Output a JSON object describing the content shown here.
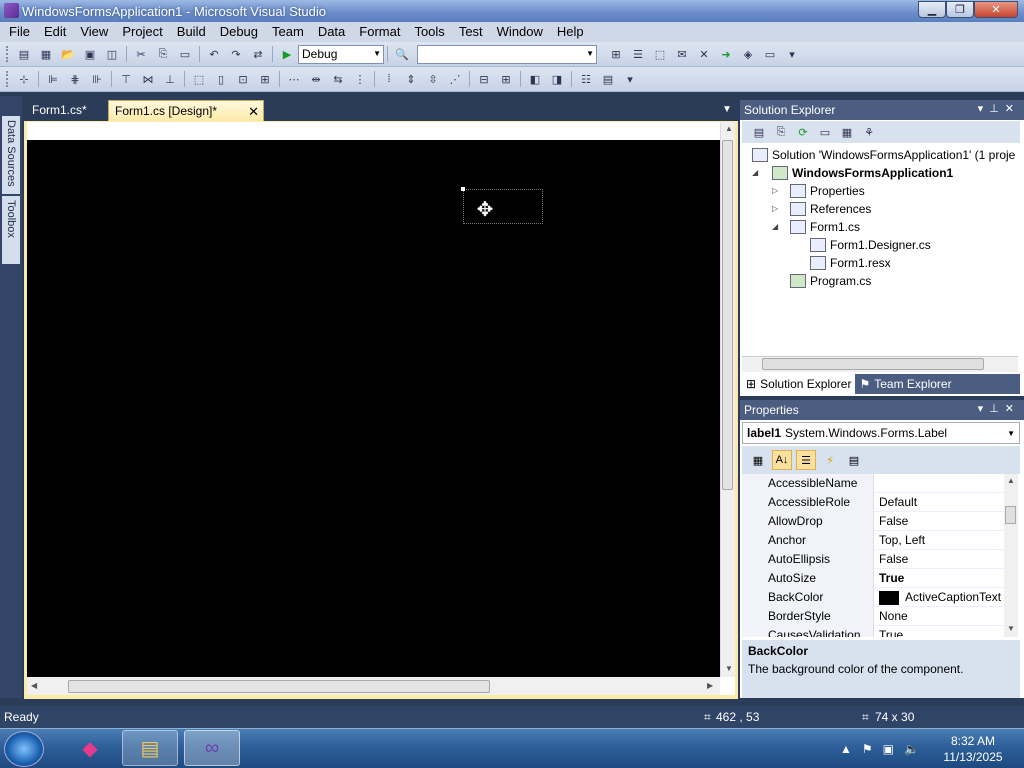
{
  "window": {
    "title": "WindowsFormsApplication1 - Microsoft Visual Studio"
  },
  "menu": [
    "File",
    "Edit",
    "View",
    "Project",
    "Build",
    "Debug",
    "Team",
    "Data",
    "Format",
    "Tools",
    "Test",
    "Window",
    "Help"
  ],
  "toolbar": {
    "configuration": "Debug",
    "platform": ""
  },
  "side_tabs": {
    "data_sources": "Data Sources",
    "toolbox": "Toolbox"
  },
  "doc_tabs": {
    "code": "Form1.cs*",
    "designer": "Form1.cs [Design]*"
  },
  "solution_explorer": {
    "title": "Solution Explorer",
    "items": [
      {
        "label": "Solution 'WindowsFormsApplication1' (1 proje"
      },
      {
        "label": "WindowsFormsApplication1"
      },
      {
        "label": "Properties"
      },
      {
        "label": "References"
      },
      {
        "label": "Form1.cs"
      },
      {
        "label": "Form1.Designer.cs"
      },
      {
        "label": "Form1.resx"
      },
      {
        "label": "Program.cs"
      }
    ],
    "tab_solution": "Solution Explorer",
    "tab_team": "Team Explorer"
  },
  "properties": {
    "title": "Properties",
    "object_name": "label1",
    "object_type": "System.Windows.Forms.Label",
    "rows": [
      {
        "name": "AccessibleName",
        "value": ""
      },
      {
        "name": "AccessibleRole",
        "value": "Default"
      },
      {
        "name": "AllowDrop",
        "value": "False"
      },
      {
        "name": "Anchor",
        "value": "Top, Left"
      },
      {
        "name": "AutoEllipsis",
        "value": "False"
      },
      {
        "name": "AutoSize",
        "value": "True"
      },
      {
        "name": "BackColor",
        "value": "ActiveCaptionText"
      },
      {
        "name": "BorderStyle",
        "value": "None"
      },
      {
        "name": "CausesValidation",
        "value": "True"
      }
    ],
    "desc_title": "BackColor",
    "desc_text": "The background color of the component."
  },
  "status": {
    "text": "Ready",
    "position": "462 , 53",
    "size": "74 x 30"
  },
  "clock": {
    "time": "8:32 AM",
    "date": "11/13/2025"
  },
  "colors": {
    "form_back": "#000000",
    "designer_frame": "#fde9a8",
    "chrome": "#2b3c59"
  }
}
